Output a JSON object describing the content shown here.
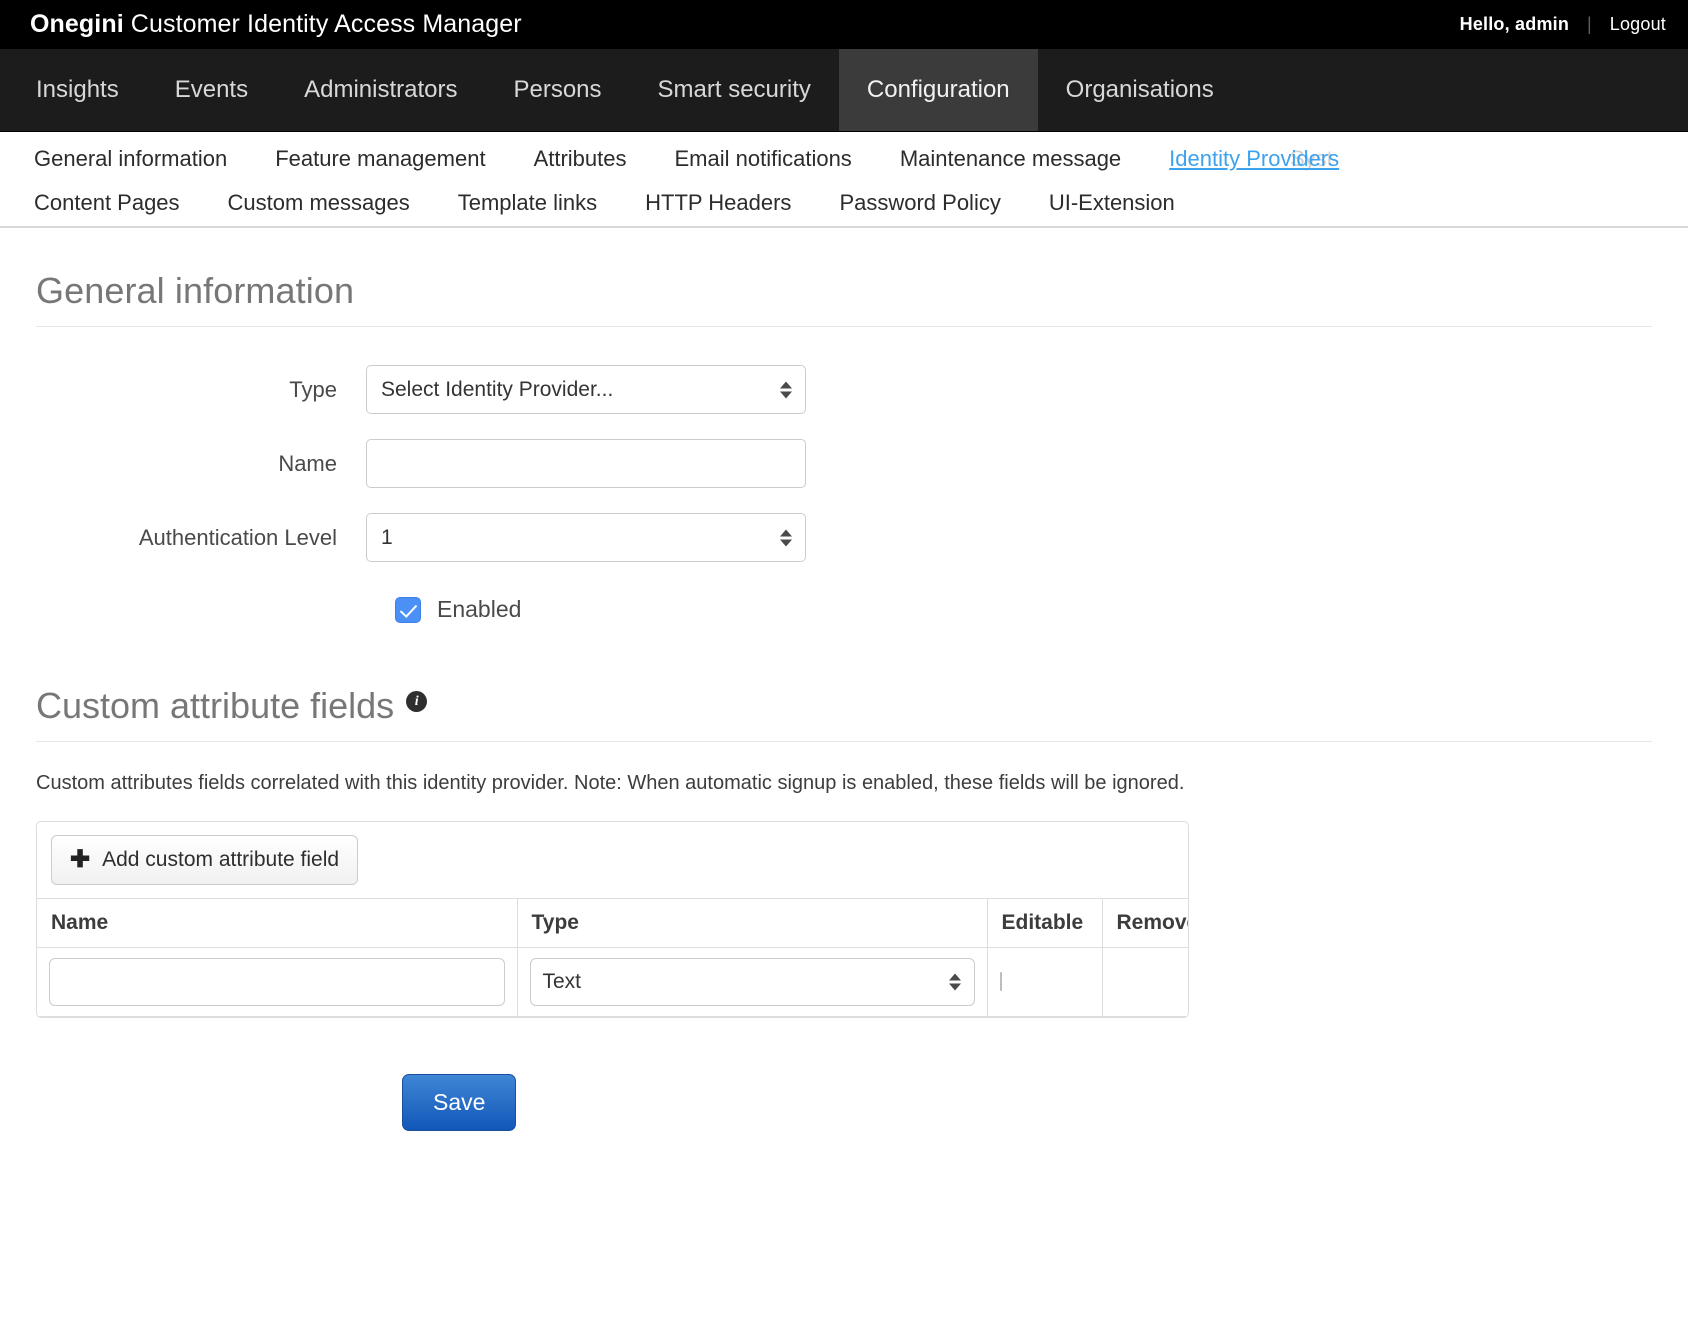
{
  "brand": {
    "name_strong": "Onegini",
    "name_rest": " Customer Identity Access Manager",
    "greeting": "Hello, admin",
    "separator": "|",
    "logout": "Logout"
  },
  "main_nav": {
    "items": [
      {
        "label": "Insights",
        "active": false
      },
      {
        "label": "Events",
        "active": false
      },
      {
        "label": "Administrators",
        "active": false
      },
      {
        "label": "Persons",
        "active": false
      },
      {
        "label": "Smart security",
        "active": false
      },
      {
        "label": "Configuration",
        "active": true
      },
      {
        "label": "Organisations",
        "active": false
      }
    ]
  },
  "sub_nav": {
    "row1": [
      {
        "label": "General information"
      },
      {
        "label": "Feature management"
      },
      {
        "label": "Attributes"
      },
      {
        "label": "Email notifications"
      },
      {
        "label": "Maintenance message"
      },
      {
        "label": "Identity Providers"
      }
    ],
    "ghost_label": "Syst",
    "row2": [
      {
        "label": "Content Pages"
      },
      {
        "label": "Custom messages"
      },
      {
        "label": "Template links"
      },
      {
        "label": "HTTP Headers"
      },
      {
        "label": "Password Policy"
      },
      {
        "label": "UI-Extension"
      }
    ]
  },
  "general_information": {
    "heading": "General information",
    "type_label": "Type",
    "type_value": "Select Identity Provider...",
    "name_label": "Name",
    "name_value": "",
    "name_placeholder": "",
    "auth_level_label": "Authentication Level",
    "auth_level_value": "1",
    "enabled_label": "Enabled",
    "enabled_checked": true
  },
  "custom_attribute_fields": {
    "heading": "Custom attribute fields",
    "info_icon_glyph": "i",
    "description": "Custom attributes fields correlated with this identity provider. Note: When automatic signup is enabled, these fields will be ignored.",
    "add_button_label": "Add custom attribute field",
    "add_button_icon": "plus-icon",
    "columns": [
      "Name",
      "Type",
      "Editable",
      "Remove"
    ],
    "rows": [
      {
        "name_value": "",
        "name_placeholder": "",
        "type_value": "Text",
        "editable_checked": false,
        "remove_label": ""
      }
    ]
  },
  "footer": {
    "save_label": "Save"
  },
  "colors": {
    "brandbar_bg": "#000000",
    "mainnav_bg": "#1c1c1c",
    "mainnav_active_bg": "#3b3b3b",
    "link_blue": "#3da2ee",
    "checkbox_blue": "#4a90f7",
    "save_blue": "#1257b8",
    "heading_grey": "#777777"
  }
}
